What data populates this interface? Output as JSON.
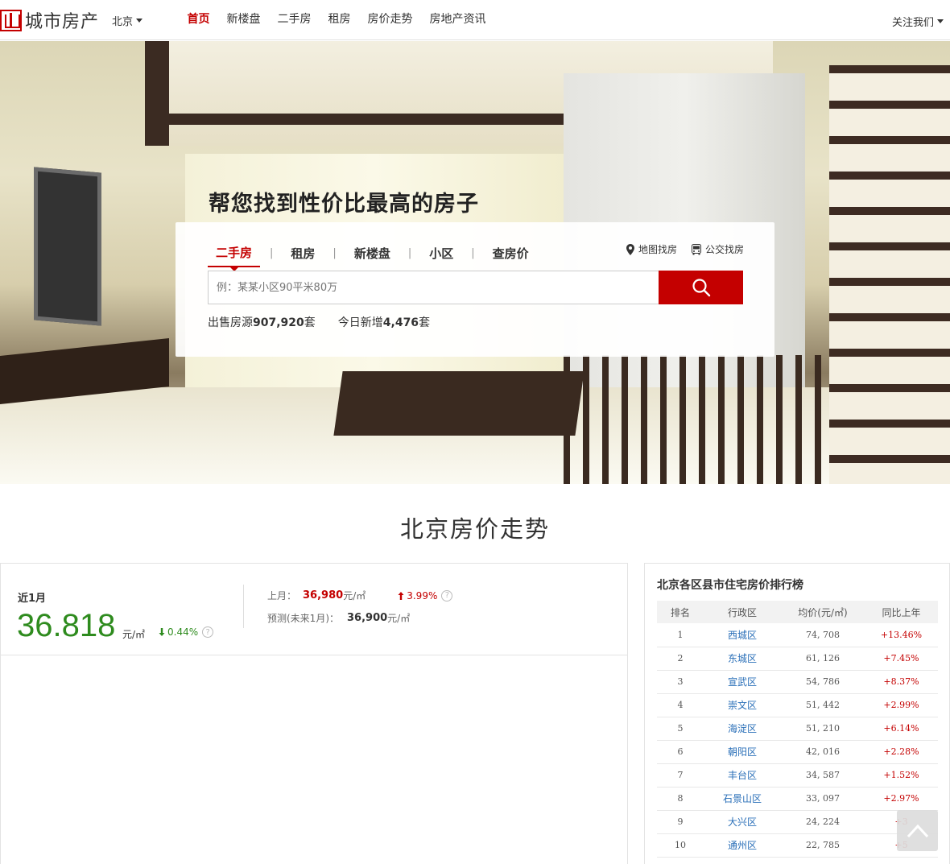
{
  "header": {
    "logo_text": "城市房产",
    "city": "北京",
    "nav": [
      {
        "label": "首页",
        "active": true
      },
      {
        "label": "新楼盘",
        "active": false
      },
      {
        "label": "二手房",
        "active": false
      },
      {
        "label": "租房",
        "active": false
      },
      {
        "label": "房价走势",
        "active": false
      },
      {
        "label": "房地产资讯",
        "active": false
      }
    ],
    "follow_label": "关注我们"
  },
  "hero": {
    "title": "帮您找到性价比最高的房子",
    "tabs": [
      "二手房",
      "租房",
      "新楼盘",
      "小区",
      "查房价"
    ],
    "active_tab": "二手房",
    "separator": "|",
    "map_search_label": "地图找房",
    "bus_search_label": "公交找房",
    "search_placeholder": "例：某某小区90平米80万",
    "stats": {
      "for_sale_prefix": "出售房源",
      "for_sale_value": "907,920",
      "for_sale_suffix": "套",
      "today_new_prefix": "今日新增",
      "today_new_value": "4,476",
      "today_new_suffix": "套"
    }
  },
  "trend": {
    "section_title": "北京房价走势",
    "recent_label": "近1月",
    "price": "36.818",
    "unit": "元/㎡",
    "change": "0.44%",
    "last_month_label": "上月：",
    "last_month_value": "36,980",
    "last_month_unit": "元/㎡",
    "last_month_change": "3.99%",
    "forecast_label": "预测(未来1月)：",
    "forecast_value": "36,900",
    "forecast_unit": "元/㎡",
    "help_mark": "?"
  },
  "ranking": {
    "title": "北京各区县市住宅房价排行榜",
    "headers": [
      "排名",
      "行政区",
      "均价(元/㎡)",
      "同比上年"
    ],
    "rows": [
      {
        "rank": "1",
        "district": "西城区",
        "avg": "74, 708",
        "yoy": "+13.46%"
      },
      {
        "rank": "2",
        "district": "东城区",
        "avg": "61, 126",
        "yoy": "+7.45%"
      },
      {
        "rank": "3",
        "district": "宣武区",
        "avg": "54, 786",
        "yoy": "+8.37%"
      },
      {
        "rank": "4",
        "district": "崇文区",
        "avg": "51, 442",
        "yoy": "+2.99%"
      },
      {
        "rank": "5",
        "district": "海淀区",
        "avg": "51, 210",
        "yoy": "+6.14%"
      },
      {
        "rank": "6",
        "district": "朝阳区",
        "avg": "42, 016",
        "yoy": "+2.28%"
      },
      {
        "rank": "7",
        "district": "丰台区",
        "avg": "34, 587",
        "yoy": "+1.52%"
      },
      {
        "rank": "8",
        "district": "石景山区",
        "avg": "33, 097",
        "yoy": "+2.97%"
      },
      {
        "rank": "9",
        "district": "大兴区",
        "avg": "24, 224",
        "yoy": "+3"
      },
      {
        "rank": "10",
        "district": "通州区",
        "avg": "22, 785",
        "yoy": "+5"
      }
    ]
  },
  "colors": {
    "brand_red": "#c40000",
    "price_green": "#2e8b1e",
    "link_blue": "#2a6fb8"
  },
  "icons": {
    "logo": "logo-mark-icon",
    "map": "map-pin-icon",
    "bus": "bus-icon",
    "search": "search-icon",
    "back_to_top": "chevron-up-icon"
  }
}
